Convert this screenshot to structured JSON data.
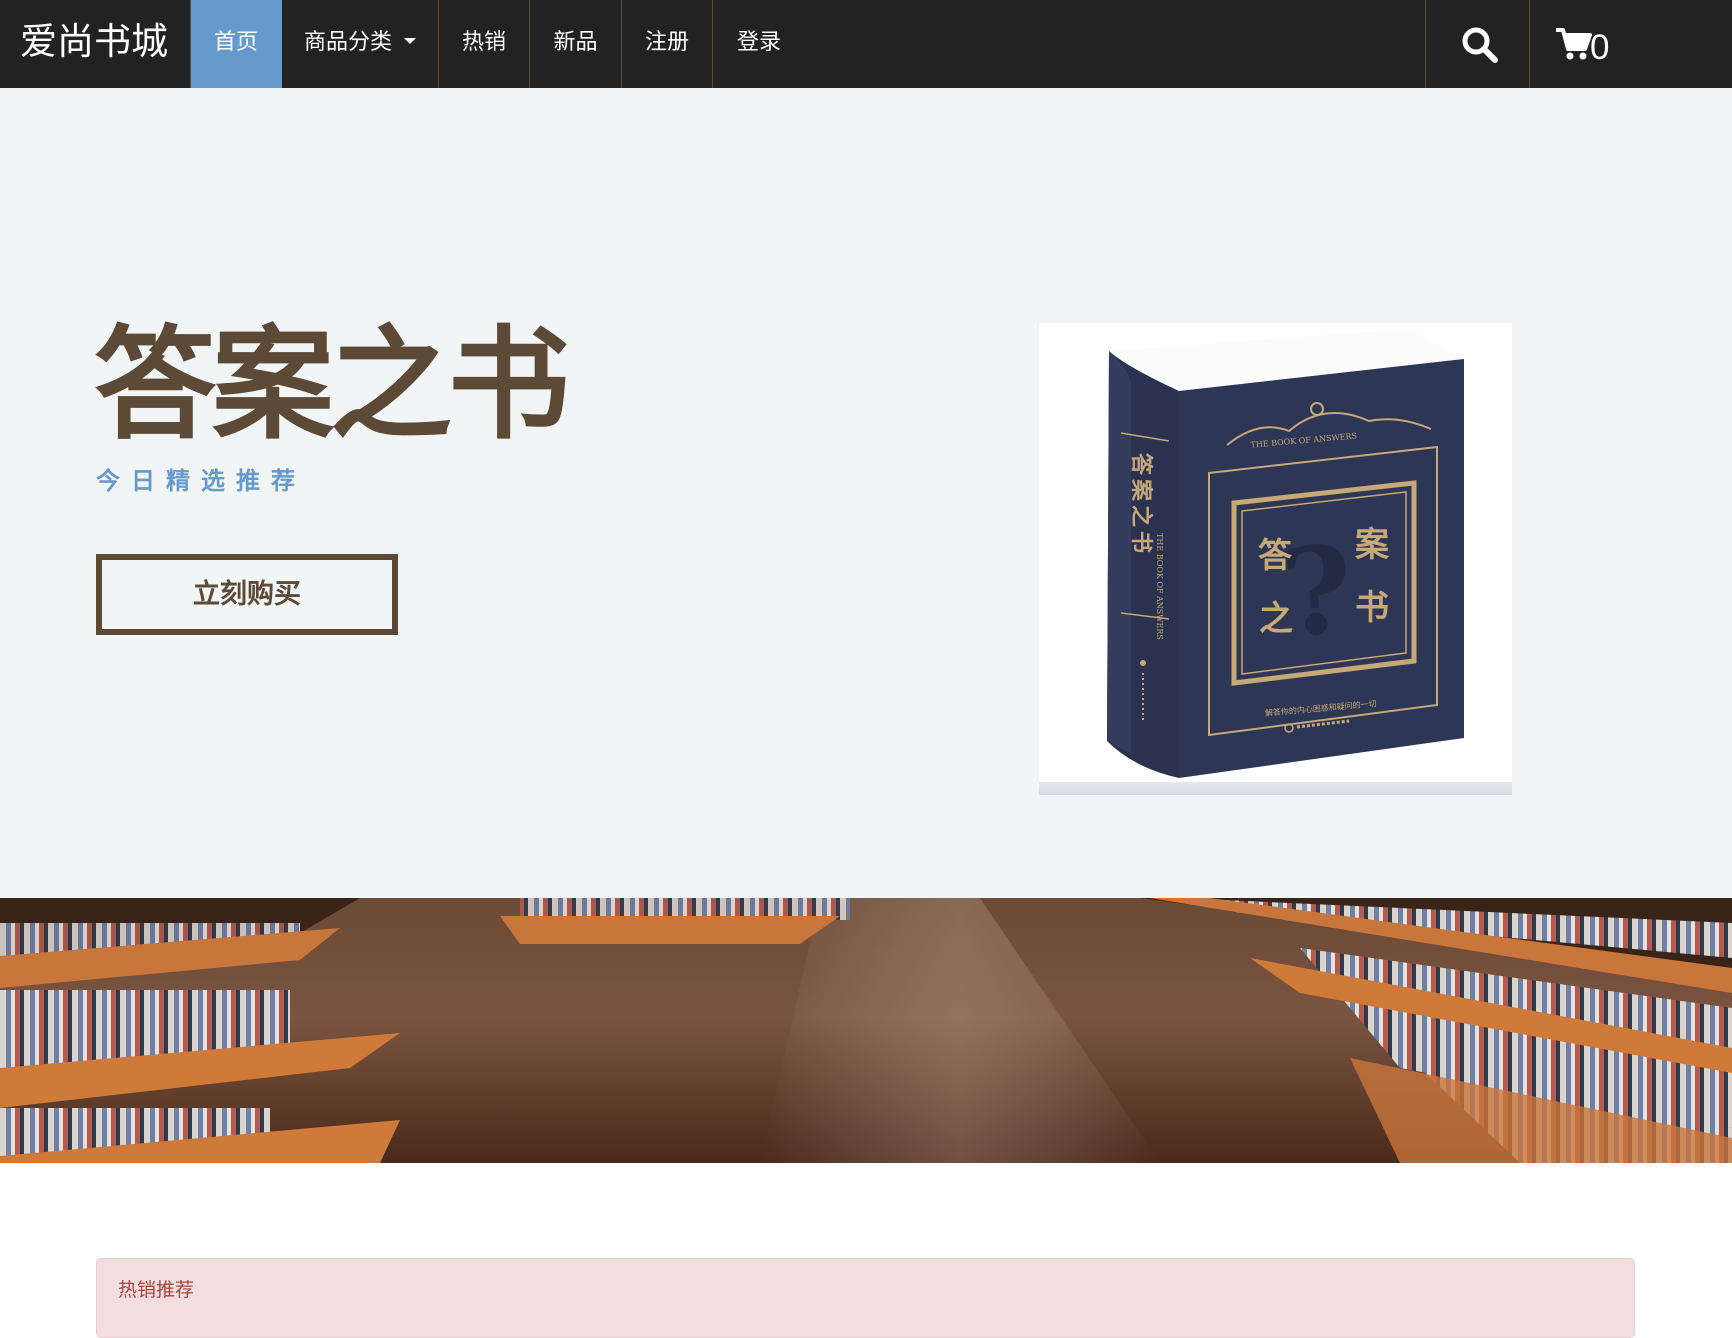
{
  "navbar": {
    "brand": "爱尚书城",
    "items": [
      {
        "label": "首页",
        "active": true
      },
      {
        "label": "商品分类",
        "has_dropdown": true
      },
      {
        "label": "热销"
      },
      {
        "label": "新品"
      },
      {
        "label": "注册"
      },
      {
        "label": "登录"
      }
    ],
    "search_icon": "search-icon",
    "cart_icon": "shopping-cart-icon",
    "cart_count": "0"
  },
  "hero": {
    "title": "答案之书",
    "subtitle": "今日精选推荐",
    "buy_button": "立刻购买",
    "book_cover": {
      "spine_title": "答案之书",
      "spine_english": "THE BOOK OF ANSWERS",
      "front_english": "THE BOOK OF ANSWERS",
      "front_chars": [
        "答",
        "案",
        "之",
        "书"
      ],
      "tagline": "解答你的内心困惑和疑问的一切"
    }
  },
  "hot_panel": {
    "title": "热销推荐"
  },
  "colors": {
    "navbar_bg": "#222222",
    "active_nav": "#6699cc",
    "hero_bg": "#f2f5f6",
    "hero_title": "#5c4a36",
    "hero_subtitle": "#6699cc",
    "panel_bg": "#f2dede",
    "panel_text": "#a94442",
    "book_navy": "#2d3654",
    "book_gold": "#c7a877"
  }
}
